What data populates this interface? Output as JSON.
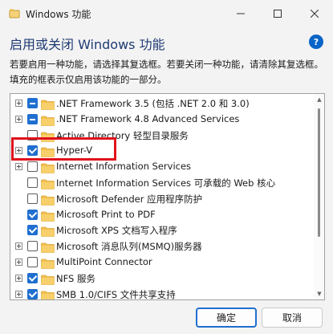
{
  "window": {
    "title": "Windows 功能"
  },
  "heading": "启用或关闭 Windows 功能",
  "description": "若要启用一种功能，请选择其复选框。若要关闭一种功能，请清除其复选框。填充的框表示仅启用该功能的一部分。",
  "features": [
    {
      "label": ".NET Framework 3.5 (包括 .NET 2.0 和 3.0)",
      "expandable": true,
      "state": "partial"
    },
    {
      "label": ".NET Framework 4.8 Advanced Services",
      "expandable": true,
      "state": "partial"
    },
    {
      "label": "Active Directory 轻型目录服务",
      "expandable": false,
      "state": "unchecked"
    },
    {
      "label": "Hyper-V",
      "expandable": true,
      "state": "checked"
    },
    {
      "label": "Internet Information Services",
      "expandable": true,
      "state": "unchecked"
    },
    {
      "label": "Internet Information Services 可承载的 Web 核心",
      "expandable": false,
      "state": "unchecked"
    },
    {
      "label": "Microsoft Defender 应用程序防护",
      "expandable": false,
      "state": "unchecked"
    },
    {
      "label": "Microsoft Print to PDF",
      "expandable": false,
      "state": "checked"
    },
    {
      "label": "Microsoft XPS 文档写入程序",
      "expandable": false,
      "state": "checked"
    },
    {
      "label": "Microsoft 消息队列(MSMQ)服务器",
      "expandable": true,
      "state": "unchecked"
    },
    {
      "label": "MultiPoint Connector",
      "expandable": true,
      "state": "unchecked"
    },
    {
      "label": "NFS 服务",
      "expandable": true,
      "state": "checked"
    },
    {
      "label": "SMB 1.0/CIFS 文件共享支持",
      "expandable": true,
      "state": "checked"
    }
  ],
  "buttons": {
    "ok": "确定",
    "cancel": "取消"
  },
  "help_icon_glyph": "?",
  "colors": {
    "accent": "#1f6fd0",
    "highlight": "#e0121c",
    "folder": "#f2c14e"
  },
  "icons": {
    "app": "windows-features-icon",
    "folder": "folder-icon",
    "help": "help-icon"
  }
}
